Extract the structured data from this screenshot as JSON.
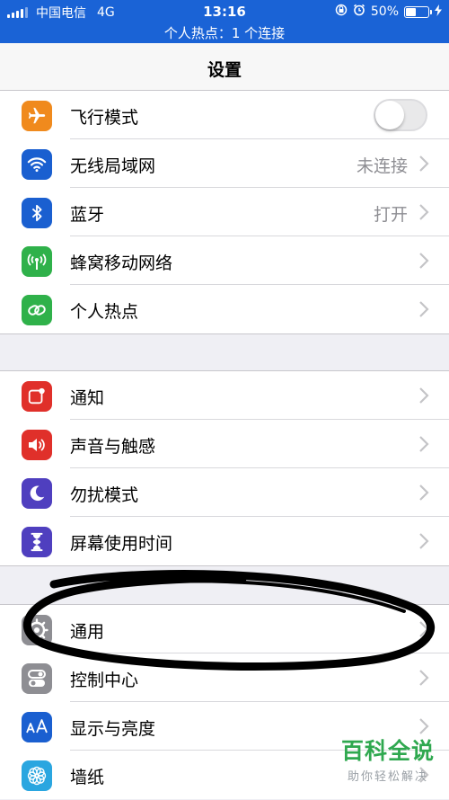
{
  "status_bar": {
    "carrier": "中国电信",
    "network": "4G",
    "time": "13:16",
    "battery_percent": "50%",
    "battery_level": 0.5,
    "hotspot_text": "个人热点：1 个连接"
  },
  "nav": {
    "title": "设置"
  },
  "groups": [
    {
      "rows": [
        {
          "label": "飞行模式",
          "icon": "airplane-icon",
          "color": "#f08a1d",
          "toggle": "off"
        },
        {
          "label": "无线局域网",
          "icon": "wifi-icon",
          "color": "#1a5fd0",
          "value": "未连接"
        },
        {
          "label": "蓝牙",
          "icon": "bluetooth-icon",
          "color": "#1a5fd0",
          "value": "打开"
        },
        {
          "label": "蜂窝移动网络",
          "icon": "antenna-icon",
          "color": "#2fb14a"
        },
        {
          "label": "个人热点",
          "icon": "hotspot-link-icon",
          "color": "#2fb14a"
        }
      ]
    },
    {
      "rows": [
        {
          "label": "通知",
          "icon": "notification-icon",
          "color": "#e0302a"
        },
        {
          "label": "声音与触感",
          "icon": "speaker-icon",
          "color": "#e0302a"
        },
        {
          "label": "勿扰模式",
          "icon": "moon-icon",
          "color": "#4f3fbf"
        },
        {
          "label": "屏幕使用时间",
          "icon": "hourglass-icon",
          "color": "#4f3fbf"
        }
      ]
    },
    {
      "rows": [
        {
          "label": "通用",
          "icon": "gear-icon",
          "color": "#8e8e93"
        },
        {
          "label": "控制中心",
          "icon": "switches-icon",
          "color": "#8e8e93"
        },
        {
          "label": "显示与亮度",
          "icon": "text-size-icon",
          "color": "#1a5fd0"
        },
        {
          "label": "墙纸",
          "icon": "flower-icon",
          "color": "#2aa6e0"
        }
      ]
    }
  ],
  "watermark": {
    "title": "百科全说",
    "subtitle": "助你轻松解决"
  },
  "annotation_color": "#000000"
}
